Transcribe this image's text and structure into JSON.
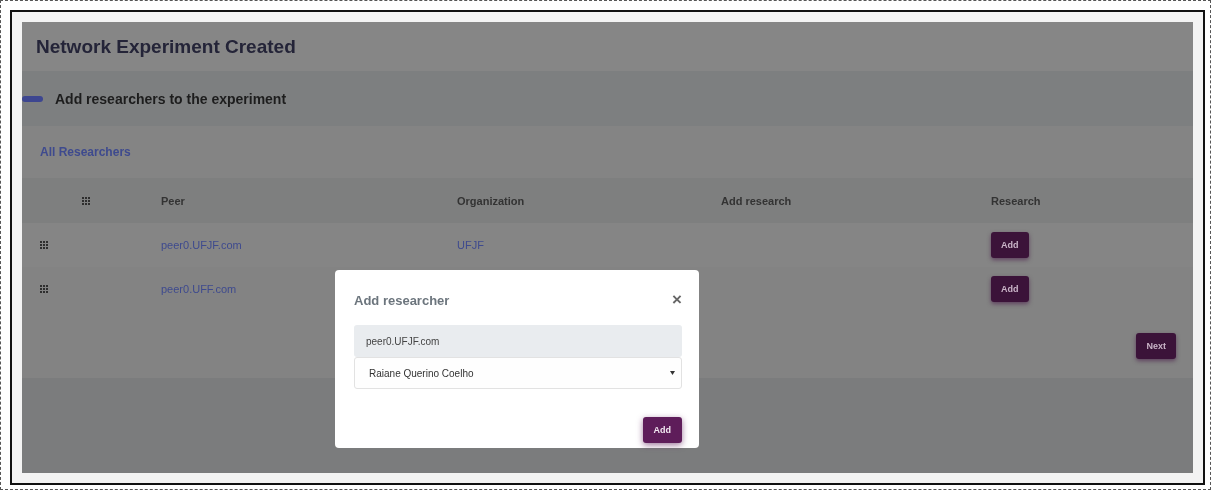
{
  "page": {
    "title": "Network Experiment Created"
  },
  "section": {
    "title": "Add researchers to the experiment",
    "expanded": true
  },
  "tab": {
    "label": "All Researchers"
  },
  "table": {
    "columns": [
      "Peer",
      "Organization",
      "Add research",
      "Research"
    ],
    "rows": [
      {
        "peer": "peer0.UFJF.com",
        "organization": "UFJF",
        "action": "Add"
      },
      {
        "peer": "peer0.UFF.com",
        "action": "Add"
      }
    ]
  },
  "next_button": "Next",
  "dialog": {
    "title": "Add researcher",
    "close": "×",
    "peer_value": "peer0.UFJF.com",
    "researcher_value": "Raiane Querino Coelho",
    "add_button": "Add"
  }
}
